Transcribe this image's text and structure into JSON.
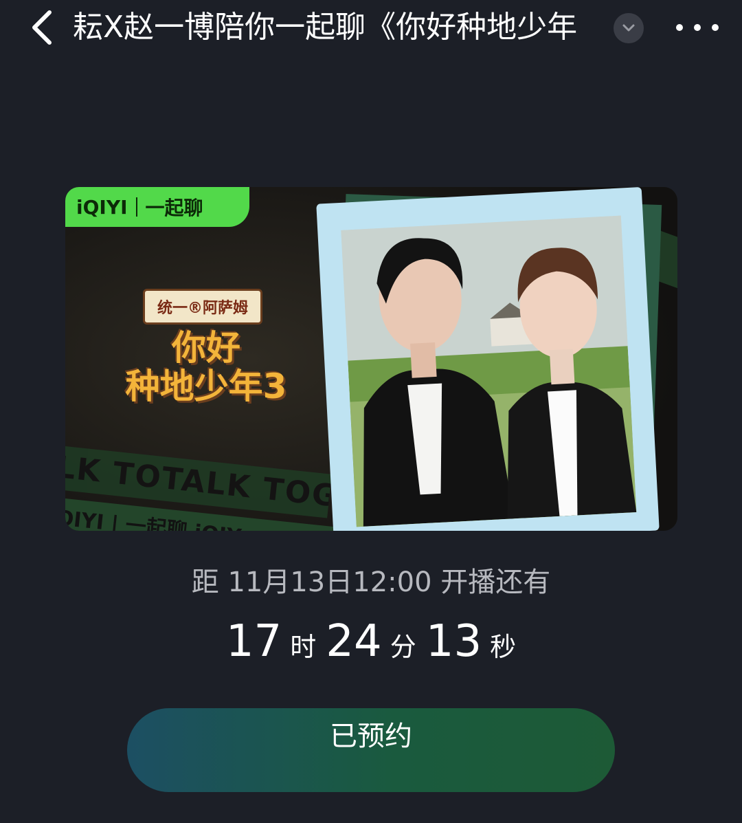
{
  "header": {
    "title": "耘X赵一博陪你一起聊《你好种地少年",
    "back_icon": "chevron-left-icon",
    "expand_icon": "chevron-down-icon",
    "more_icon": "more-dots-icon"
  },
  "banner": {
    "brand": "iQIYI",
    "brand_sub": "一起聊",
    "logo_top": "统一®阿萨姆",
    "logo_line1": "你好",
    "logo_line2": "种地少年3",
    "strip_text": "LK TOTALK TOG",
    "bottom_strip_text": "QIYI | 一起聊   iQIY",
    "colors": {
      "brand_green": "#52d94a",
      "logo_gold": "#f3b43a"
    }
  },
  "countdown": {
    "caption": "距 11月13日12:00 开播还有",
    "hours": "17",
    "hours_unit": "时",
    "minutes": "24",
    "minutes_unit": "分",
    "seconds": "13",
    "seconds_unit": "秒"
  },
  "reserve_button": {
    "label": "已预约"
  }
}
